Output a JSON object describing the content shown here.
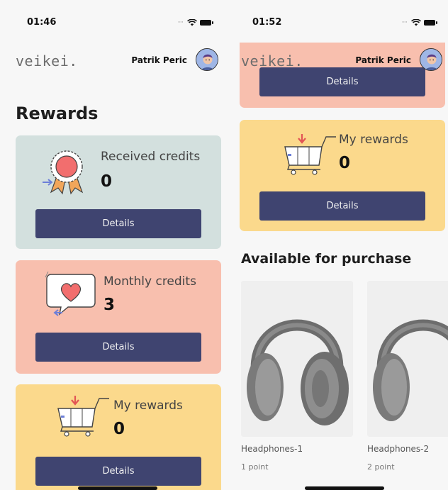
{
  "left_screen": {
    "status": {
      "time": "01:46"
    },
    "header": {
      "logo": "veikei.",
      "user_name": "Patrik Peric"
    },
    "title": "Rewards",
    "cards": {
      "received": {
        "label": "Received credits",
        "value": "0",
        "button": "Details",
        "icon": "rosette-badge-icon",
        "color": "#d3e0de"
      },
      "monthly": {
        "label": "Monthly credits",
        "value": "3",
        "button": "Details",
        "icon": "heart-speech-bubble-icon",
        "color": "#f8bfae"
      },
      "my_rewards": {
        "label": "My rewards",
        "value": "0",
        "button": "Details",
        "icon": "shopping-cart-icon",
        "color": "#fbd98c"
      }
    }
  },
  "right_screen": {
    "status": {
      "time": "01:52"
    },
    "header": {
      "logo": "veikei.",
      "user_name": "Patrik Peric"
    },
    "top_card": {
      "button": "Details"
    },
    "my_rewards": {
      "label": "My rewards",
      "value": "0",
      "button": "Details",
      "icon": "shopping-cart-icon"
    },
    "section_title": "Available for purchase",
    "products": [
      {
        "name": "Headphones-1",
        "points": "1 point",
        "icon": "headphones-image"
      },
      {
        "name": "Headphones-2",
        "points": "2 point",
        "icon": "headphones-image"
      }
    ]
  },
  "colors": {
    "button": "#3f4470",
    "background": "#f7f7f7"
  }
}
